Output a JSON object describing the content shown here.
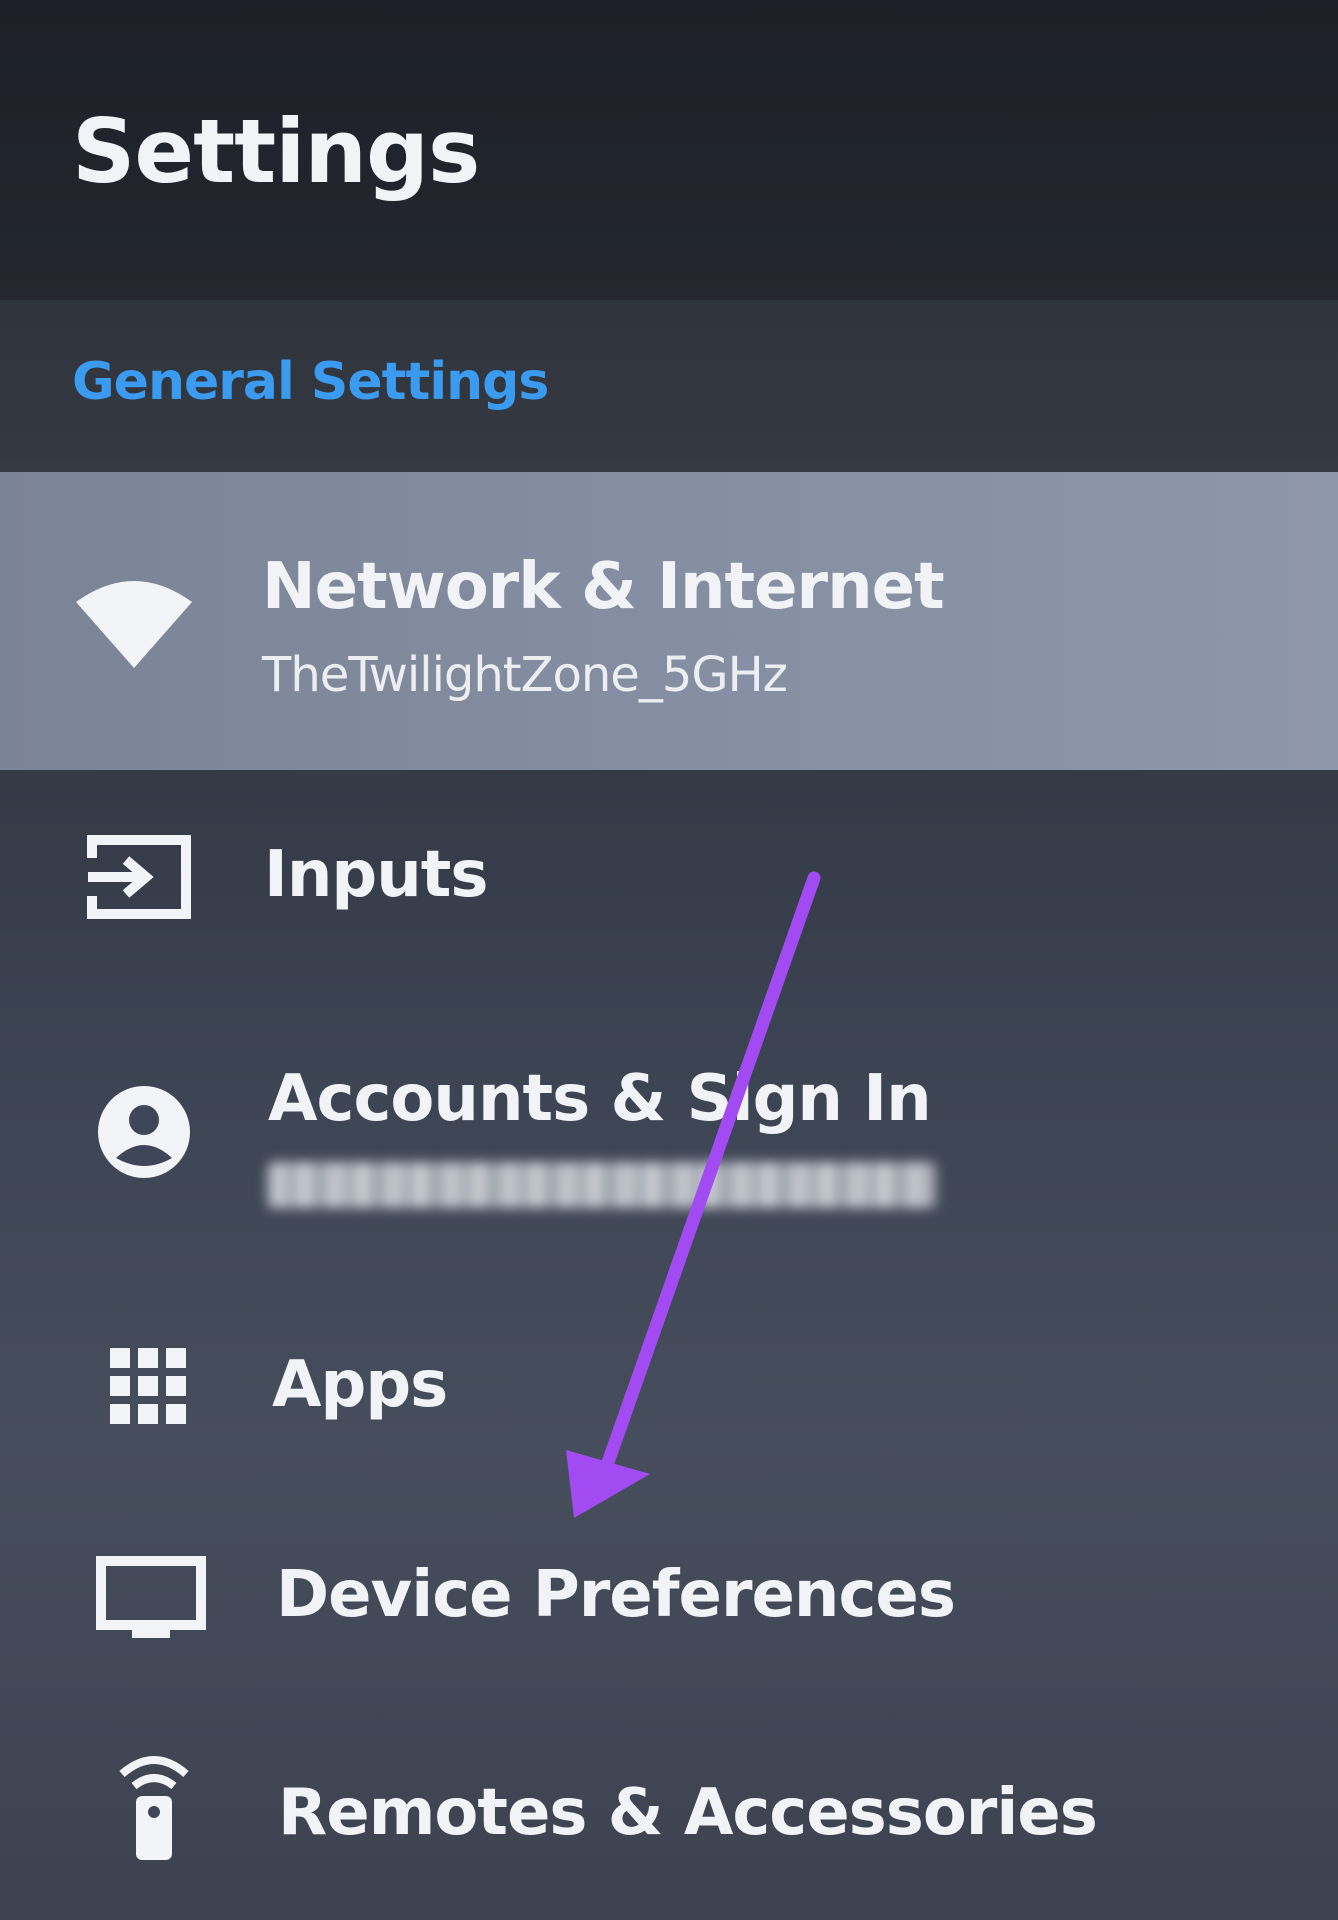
{
  "header": {
    "title": "Settings"
  },
  "section": {
    "label": "General Settings"
  },
  "items": [
    {
      "label": "Network & Internet",
      "sub": "TheTwilightZone_5GHz",
      "icon": "wifi-icon"
    },
    {
      "label": "Inputs",
      "icon": "input-icon"
    },
    {
      "label": "Accounts & Sign In",
      "sub": "",
      "icon": "account-icon"
    },
    {
      "label": "Apps",
      "icon": "apps-grid-icon"
    },
    {
      "label": "Device Preferences",
      "icon": "tv-icon"
    },
    {
      "label": "Remotes & Accessories",
      "icon": "remote-icon"
    }
  ],
  "colors": {
    "accent": "#3a9bf0",
    "annotation_arrow": "#a24bf2",
    "focus": "#858ea2"
  }
}
